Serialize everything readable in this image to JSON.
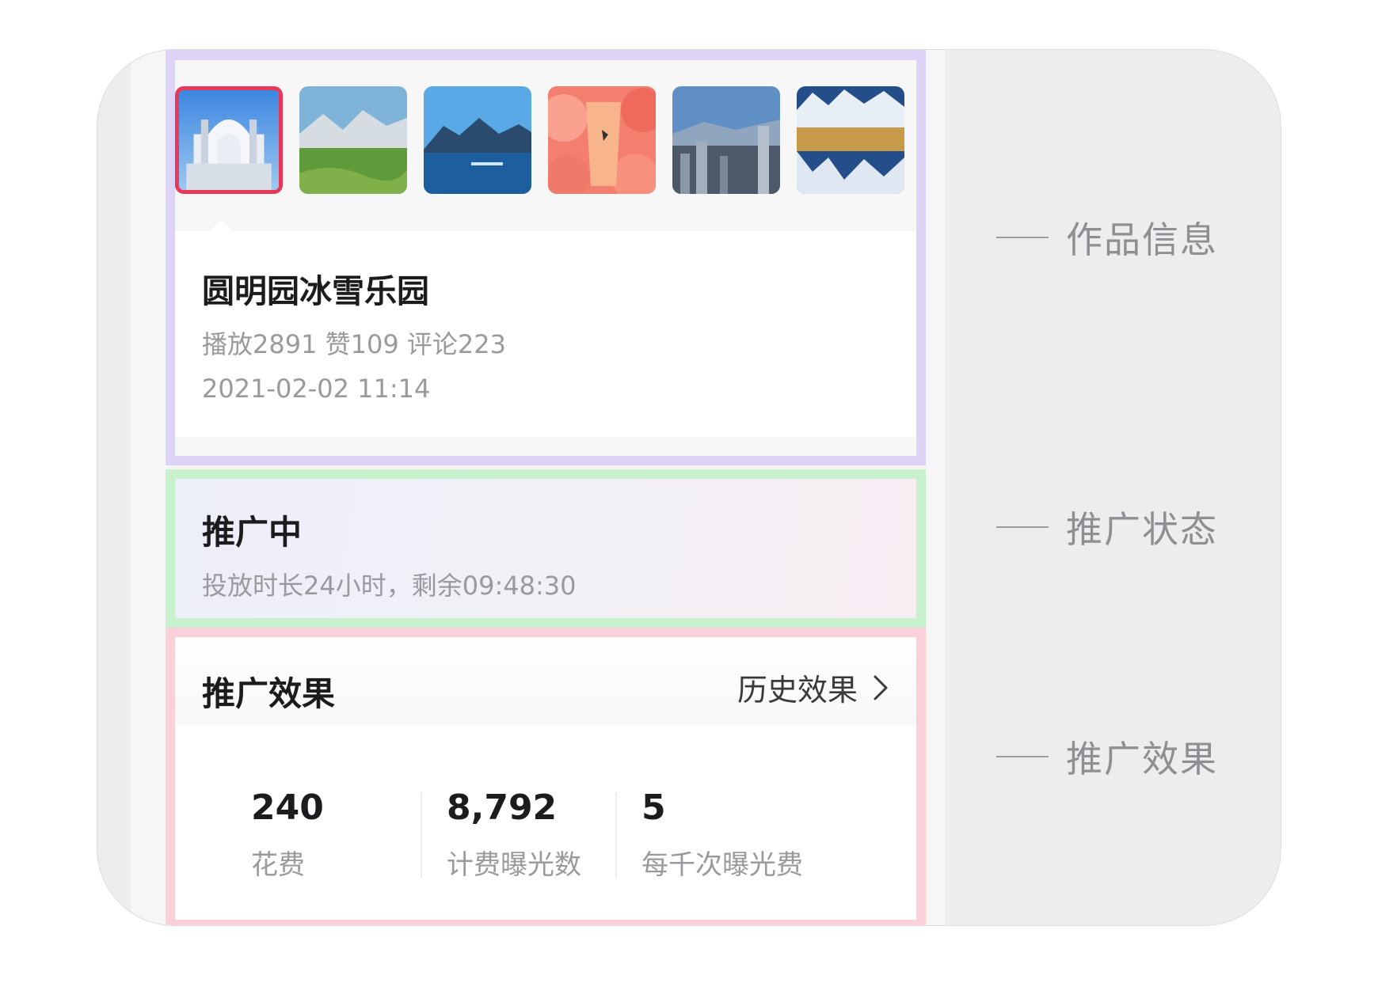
{
  "work_info": {
    "thumbnails": [
      {
        "name": "palace-ruins-thumbnail",
        "selected": true
      },
      {
        "name": "grassland-mountain-thumbnail",
        "selected": false
      },
      {
        "name": "lake-mountain-thumbnail",
        "selected": false
      },
      {
        "name": "peach-drink-thumbnail",
        "selected": false
      },
      {
        "name": "city-skyline-thumbnail",
        "selected": false
      },
      {
        "name": "snow-mountain-thumbnail",
        "selected": false
      }
    ],
    "title": "圆明园冰雪乐园",
    "stats": "播放2891 赞109 评论223",
    "time": "2021-02-02 11:14"
  },
  "promotion_status": {
    "title": "推广中",
    "desc": "投放时长24小时，剩余09:48:30"
  },
  "promotion_effect": {
    "title": "推广效果",
    "history_label": "历史效果",
    "history_icon": "chevron-right-icon",
    "metrics": [
      {
        "value": "240",
        "label": "花费"
      },
      {
        "value": "8,792",
        "label": "计费曝光数"
      },
      {
        "value": "5",
        "label": "每千次曝光费"
      }
    ]
  },
  "annotations": {
    "work_info": "作品信息",
    "status": "推广状态",
    "effect": "推广效果"
  },
  "colors": {
    "info_border": "#ddd3f6",
    "status_border": "#c7f0cc",
    "effect_border": "#fbd0d8",
    "selected_thumb": "#e8385a"
  }
}
